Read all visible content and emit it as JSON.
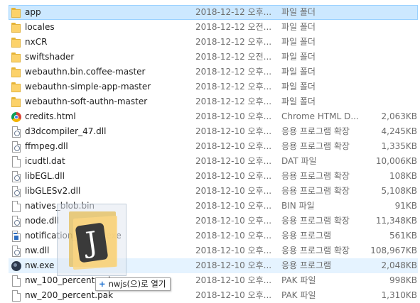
{
  "files": [
    {
      "name": "app",
      "date": "2018-12-12 오후...",
      "type": "파일 폴더",
      "size": "",
      "icon": "folder-icon",
      "state": "selected"
    },
    {
      "name": "locales",
      "date": "2018-12-12 오전...",
      "type": "파일 폴더",
      "size": "",
      "icon": "folder-icon",
      "state": ""
    },
    {
      "name": "nxCR",
      "date": "2018-12-12 오후...",
      "type": "파일 폴더",
      "size": "",
      "icon": "folder-icon",
      "state": ""
    },
    {
      "name": "swiftshader",
      "date": "2018-12-12 오전...",
      "type": "파일 폴더",
      "size": "",
      "icon": "folder-icon",
      "state": ""
    },
    {
      "name": "webauthn.bin.coffee-master",
      "date": "2018-12-12 오후...",
      "type": "파일 폴더",
      "size": "",
      "icon": "folder-icon",
      "state": ""
    },
    {
      "name": "webauthn-simple-app-master",
      "date": "2018-12-12 오후...",
      "type": "파일 폴더",
      "size": "",
      "icon": "folder-icon",
      "state": ""
    },
    {
      "name": "webauthn-soft-authn-master",
      "date": "2018-12-12 오후...",
      "type": "파일 폴더",
      "size": "",
      "icon": "folder-icon",
      "state": ""
    },
    {
      "name": "credits.html",
      "date": "2018-12-10 오후...",
      "type": "Chrome HTML D...",
      "size": "2,063KB",
      "icon": "chrome-icon",
      "state": ""
    },
    {
      "name": "d3dcompiler_47.dll",
      "date": "2018-12-10 오후...",
      "type": "응용 프로그램 확장",
      "size": "4,245KB",
      "icon": "dll-gear-icon",
      "state": ""
    },
    {
      "name": "ffmpeg.dll",
      "date": "2018-12-10 오후...",
      "type": "응용 프로그램 확장",
      "size": "1,335KB",
      "icon": "dll-gear-icon",
      "state": ""
    },
    {
      "name": "icudtl.dat",
      "date": "2018-12-10 오후...",
      "type": "DAT 파일",
      "size": "10,006KB",
      "icon": "file-icon",
      "state": ""
    },
    {
      "name": "libEGL.dll",
      "date": "2018-12-10 오후...",
      "type": "응용 프로그램 확장",
      "size": "108KB",
      "icon": "dll-gear-icon",
      "state": ""
    },
    {
      "name": "libGLESv2.dll",
      "date": "2018-12-10 오후...",
      "type": "응용 프로그램 확장",
      "size": "5,108KB",
      "icon": "dll-gear-icon",
      "state": ""
    },
    {
      "name": "natives_blob.bin",
      "date": "2018-12-10 오후...",
      "type": "BIN 파일",
      "size": "91KB",
      "icon": "file-icon",
      "state": ""
    },
    {
      "name": "node.dll",
      "date": "2018-12-10 오후...",
      "type": "응용 프로그램 확장",
      "size": "11,348KB",
      "icon": "dll-gear-icon",
      "state": ""
    },
    {
      "name": "notification_helper.exe",
      "date": "2018-12-10 오후...",
      "type": "응용 프로그램",
      "size": "561KB",
      "icon": "window-exe-icon",
      "state": ""
    },
    {
      "name": "nw.dll",
      "date": "2018-12-10 오후...",
      "type": "응용 프로그램 확장",
      "size": "108,967KB",
      "icon": "dll-gear-icon",
      "state": ""
    },
    {
      "name": "nw.exe",
      "date": "2018-12-10 오후...",
      "type": "응용 프로그램",
      "size": "2,048KB",
      "icon": "nwjs-exe-icon",
      "state": "hover"
    },
    {
      "name": "nw_100_percent.pak",
      "date": "2018-12-10 오후...",
      "type": "PAK 파일",
      "size": "998KB",
      "icon": "file-icon",
      "state": ""
    },
    {
      "name": "nw_200_percent.pak",
      "date": "2018-12-10 오후...",
      "type": "PAK 파일",
      "size": "1,310KB",
      "icon": "file-icon",
      "state": ""
    }
  ],
  "drag": {
    "ghost_glyph": "J",
    "tooltip_plus": "+",
    "tooltip_text": "nwjs(으)로 열기"
  }
}
